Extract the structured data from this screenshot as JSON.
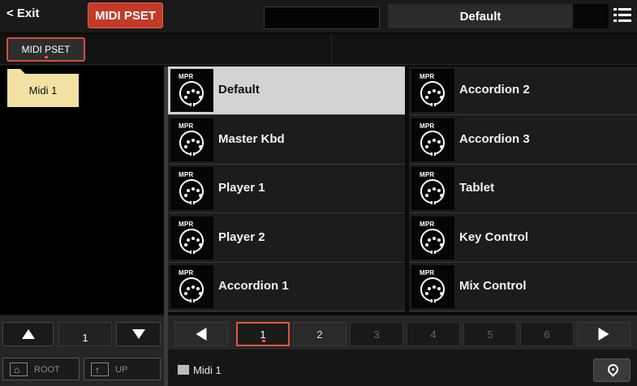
{
  "topbar": {
    "exit_label": "< Exit",
    "mode_label": "MIDI PSET",
    "current_name": "Default",
    "menu_icon": "list-menu-icon"
  },
  "tabs": [
    {
      "label": "MIDI PSET",
      "selected": true
    }
  ],
  "folders": [
    {
      "label": "Midi 1",
      "selected": true
    }
  ],
  "item_badge": "MPR",
  "item_icon": "midi-connector-icon",
  "items": [
    {
      "label": "Default",
      "selected": true
    },
    {
      "label": "Master Kbd"
    },
    {
      "label": "Player 1"
    },
    {
      "label": "Player 2"
    },
    {
      "label": "Accordion 1"
    },
    {
      "label": "Accordion 2"
    },
    {
      "label": "Accordion 3"
    },
    {
      "label": "Tablet"
    },
    {
      "label": "Key  Control"
    },
    {
      "label": "Mix Control"
    }
  ],
  "left_nav": {
    "page": "1"
  },
  "nav_buttons": {
    "root_label": "ROOT",
    "up_label": "UP"
  },
  "pager": {
    "pages": [
      "1",
      "2",
      "3",
      "4",
      "5",
      "6"
    ],
    "current": "1"
  },
  "path": {
    "label": "Midi 1"
  },
  "colors": {
    "accent": "#c33a27",
    "selected_item": "#d3d3d3",
    "folder": "#f3e1a3"
  }
}
